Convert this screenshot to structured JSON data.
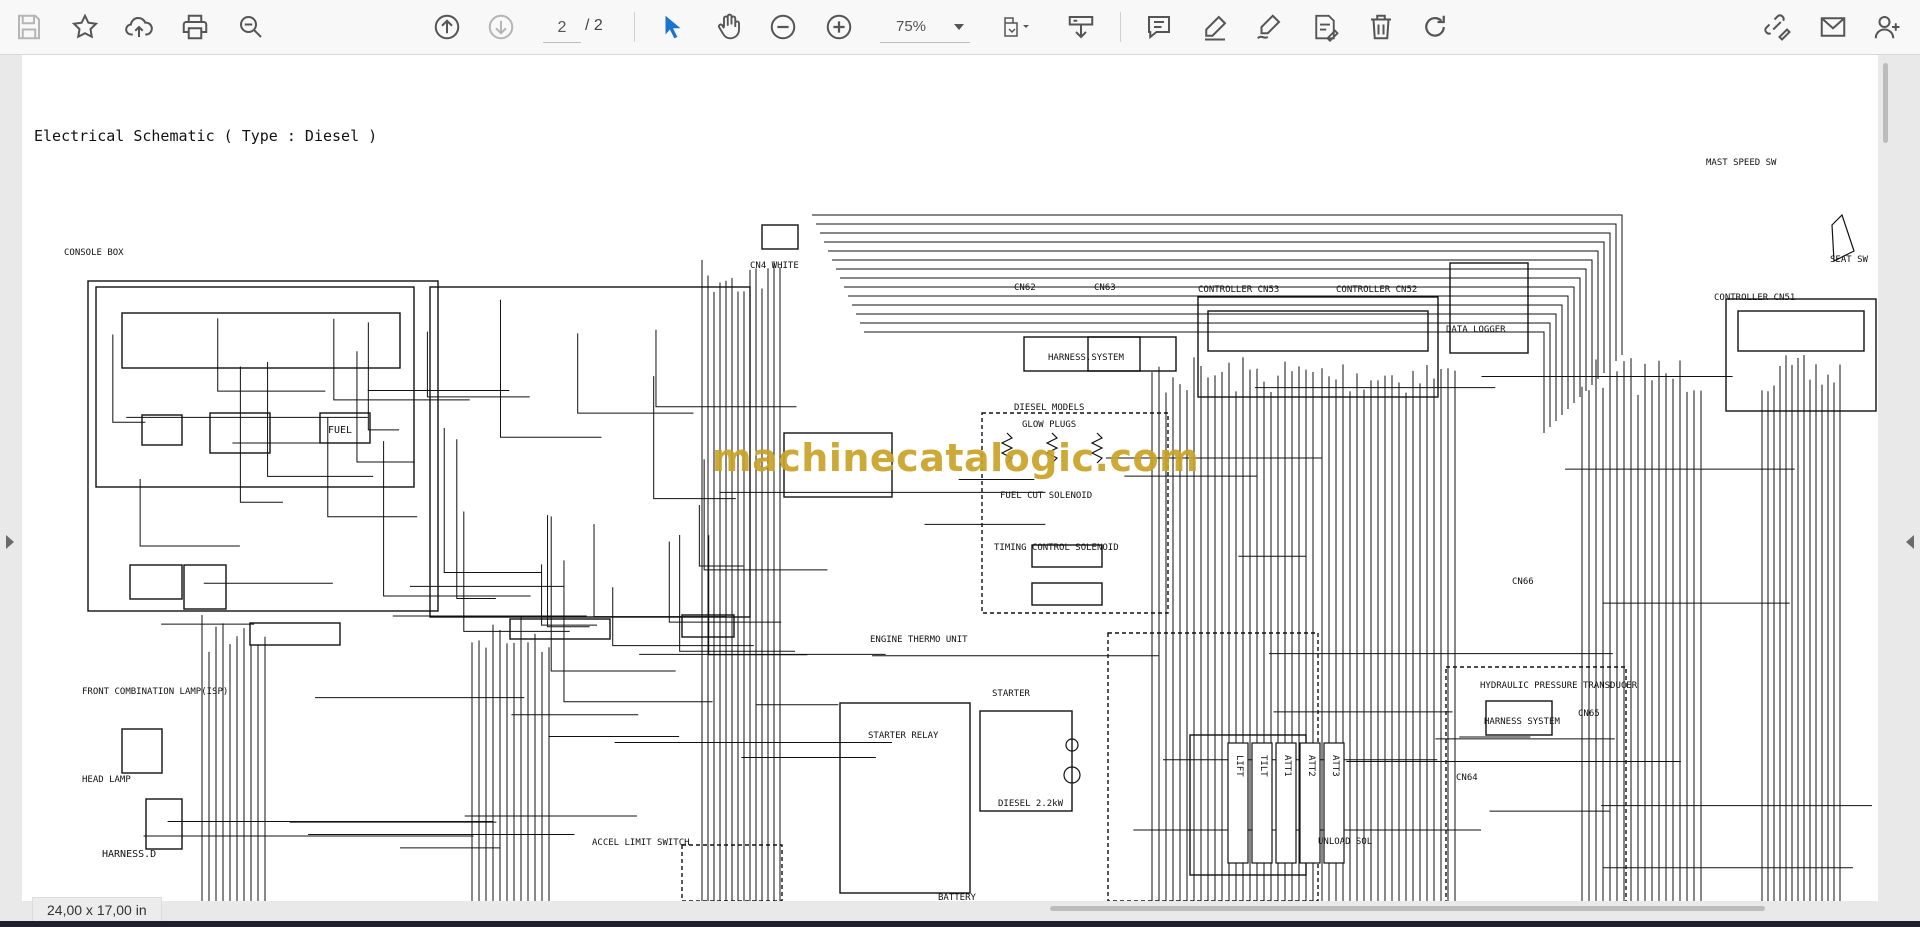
{
  "toolbar": {
    "buttons": [
      "save-icon",
      "bookmark-star-icon",
      "upload-cloud-icon",
      "print-icon",
      "zoom-search-icon",
      "previous-page-icon",
      "next-page-icon",
      "select-cursor-icon",
      "hand-pan-icon",
      "zoom-out-icon",
      "zoom-in-icon",
      "fit-page-icon",
      "download-tray-icon",
      "comment-icon",
      "highlight-pen-icon",
      "draw-sign-icon",
      "stamp-edit-icon",
      "delete-icon",
      "rotate-icon",
      "link-edit-icon",
      "mail-icon",
      "user-add-icon"
    ],
    "page_current": "2",
    "page_total": "/ 2",
    "zoom_value": "75%"
  },
  "document": {
    "title": "Electrical Schematic ( Type : Diesel )",
    "watermark": "machinecatalogic.com",
    "labels": {
      "console_box": "CONSOLE BOX",
      "front_combination_lamp": "FRONT COMBINATION LAMP(ISP)",
      "head_lamp": "HEAD LAMP",
      "harness_d": "HARNESS.D",
      "accel_limit_switch": "ACCEL LIMIT SWITCH",
      "cn4_white": "CN4 WHITE",
      "cn62": "CN62",
      "cn63": "CN63",
      "harness_system": "HARNESS.SYSTEM",
      "diesel_models": "DIESEL MODELS",
      "glow_plugs": "GLOW PLUGS",
      "fuel_cut_solenoid": "FUEL CUT SOLENOID",
      "timing_control_solenoid": "TIMING CONTROL SOLENOID",
      "engine_thermo_unit": "ENGINE THERMO UNIT",
      "starter": "STARTER",
      "starter_relay": "STARTER RELAY",
      "diesel_kw": "DIESEL 2.2kW",
      "battery": "BATTERY",
      "controller_cn53": "CONTROLLER CN53",
      "controller_cn52": "CONTROLLER CN52",
      "controller_cn51": "CONTROLLER CN51",
      "data_logger": "DATA LOGGER",
      "mast_speed_sw": "MAST SPEED SW",
      "seat_sw": "SEAT SW",
      "hydraulic_pressure_transducer": "HYDRAULIC PRESSURE TRANSDUCER",
      "harness_system_2": "HARNESS SYSTEM",
      "cn65": "CN65",
      "cn66": "CN66",
      "cn64": "CN64",
      "unload_sol": "UNLOAD SOL",
      "fuel": "FUEL",
      "valves": [
        "LIFT",
        "TILT",
        "ATT1",
        "ATT2",
        "ATT3"
      ]
    }
  },
  "status": {
    "page_size": "24,00 x 17,00 in"
  }
}
